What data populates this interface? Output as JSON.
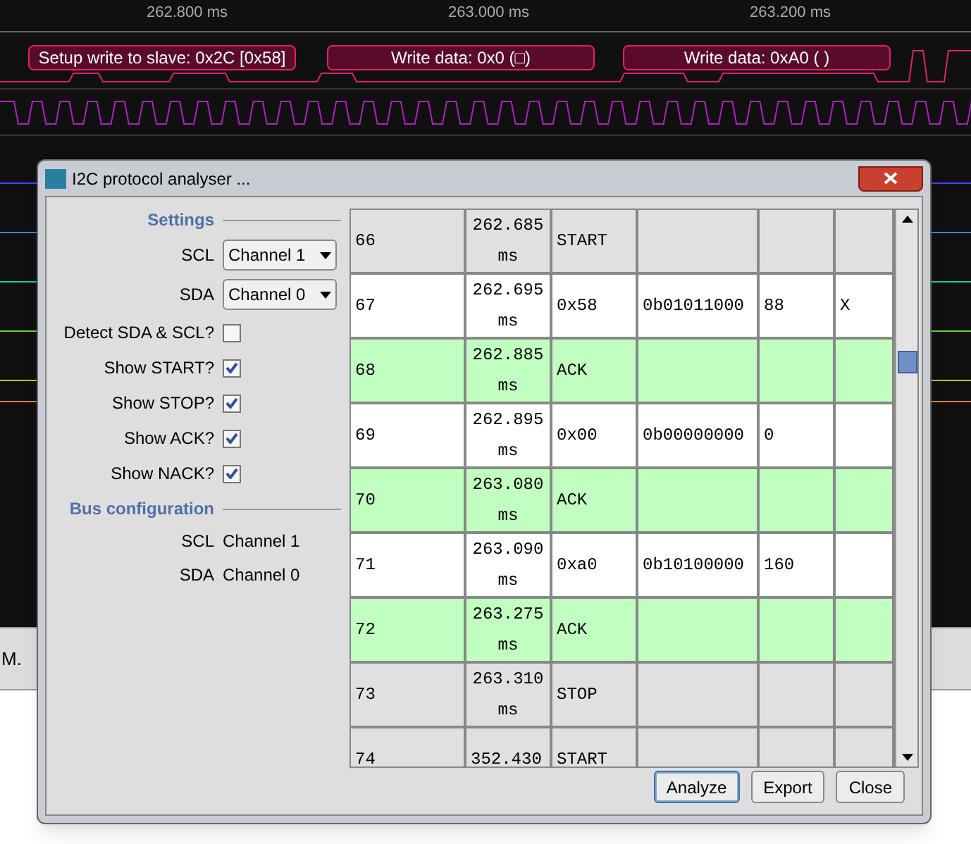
{
  "ruler": {
    "ticks": [
      "262.800 ms",
      "263.000 ms",
      "263.200 ms"
    ]
  },
  "annotations": [
    "Setup write to slave: 0x2C [0x58]",
    "Write data: 0x0 (□)",
    "Write data: 0xA0 ( )"
  ],
  "background_text": "M.",
  "dialog": {
    "title": "I2C protocol analyser ...",
    "settings": {
      "heading": "Settings",
      "selects": [
        {
          "label": "SCL",
          "value": "Channel 1"
        },
        {
          "label": "SDA",
          "value": "Channel 0"
        }
      ],
      "checkboxes": [
        {
          "label": "Detect SDA & SCL?",
          "checked": false
        },
        {
          "label": "Show START?",
          "checked": true
        },
        {
          "label": "Show STOP?",
          "checked": true
        },
        {
          "label": "Show ACK?",
          "checked": true
        },
        {
          "label": "Show NACK?",
          "checked": true
        }
      ]
    },
    "bus_configuration": {
      "heading": "Bus configuration",
      "rows": [
        {
          "label": "SCL",
          "value": "Channel 1"
        },
        {
          "label": "SDA",
          "value": "Channel 0"
        }
      ]
    },
    "table": {
      "rows": [
        {
          "kind": "start",
          "cells": [
            "66",
            "262.685 ms",
            "START",
            "",
            "",
            ""
          ]
        },
        {
          "kind": "data",
          "cells": [
            "67",
            "262.695 ms",
            "0x58",
            "0b01011000",
            "88",
            "X"
          ]
        },
        {
          "kind": "ack",
          "cells": [
            "68",
            "262.885 ms",
            "ACK",
            "",
            "",
            ""
          ]
        },
        {
          "kind": "data",
          "cells": [
            "69",
            "262.895 ms",
            "0x00",
            "0b00000000",
            "0",
            ""
          ]
        },
        {
          "kind": "ack",
          "cells": [
            "70",
            "263.080 ms",
            "ACK",
            "",
            "",
            ""
          ]
        },
        {
          "kind": "data",
          "cells": [
            "71",
            "263.090 ms",
            "0xa0",
            "0b10100000",
            "160",
            ""
          ]
        },
        {
          "kind": "ack",
          "cells": [
            "72",
            "263.275 ms",
            "ACK",
            "",
            "",
            ""
          ]
        },
        {
          "kind": "stop",
          "cells": [
            "73",
            "263.310 ms",
            "STOP",
            "",
            "",
            ""
          ]
        },
        {
          "kind": "start",
          "cells": [
            "74",
            "352.430",
            "START",
            "",
            "",
            ""
          ]
        }
      ]
    },
    "buttons": [
      {
        "label": "Analyze",
        "selected": true
      },
      {
        "label": "Export",
        "selected": false
      },
      {
        "label": "Close",
        "selected": false
      }
    ]
  }
}
